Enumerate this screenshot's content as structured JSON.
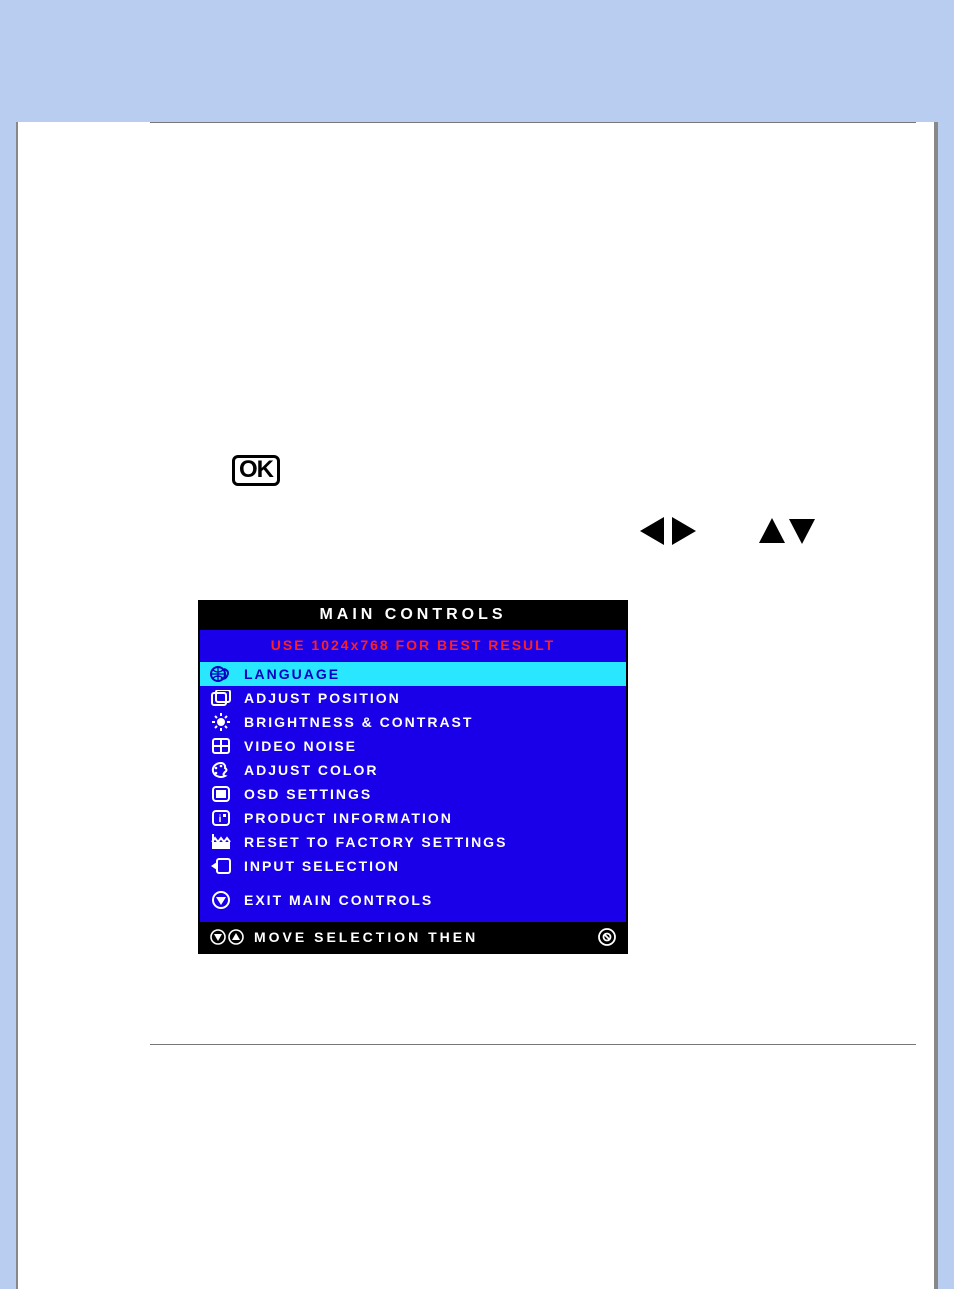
{
  "ok_label": "OK",
  "osd": {
    "title": "MAIN CONTROLS",
    "hint": "USE 1024x768 FOR BEST RESULT",
    "items": [
      {
        "label": "LANGUAGE",
        "icon": "language-icon",
        "selected": true
      },
      {
        "label": "ADJUST POSITION",
        "icon": "position-icon",
        "selected": false
      },
      {
        "label": "BRIGHTNESS & CONTRAST",
        "icon": "sun-icon",
        "selected": false
      },
      {
        "label": "VIDEO NOISE",
        "icon": "grid-icon",
        "selected": false
      },
      {
        "label": "ADJUST COLOR",
        "icon": "palette-icon",
        "selected": false
      },
      {
        "label": "OSD SETTINGS",
        "icon": "screen-icon",
        "selected": false
      },
      {
        "label": "PRODUCT INFORMATION",
        "icon": "info-icon",
        "selected": false
      },
      {
        "label": "RESET TO FACTORY SETTINGS",
        "icon": "factory-icon",
        "selected": false
      },
      {
        "label": "INPUT SELECTION",
        "icon": "input-icon",
        "selected": false
      }
    ],
    "exit_label": "EXIT MAIN CONTROLS",
    "footer_text": "MOVE SELECTION THEN"
  }
}
